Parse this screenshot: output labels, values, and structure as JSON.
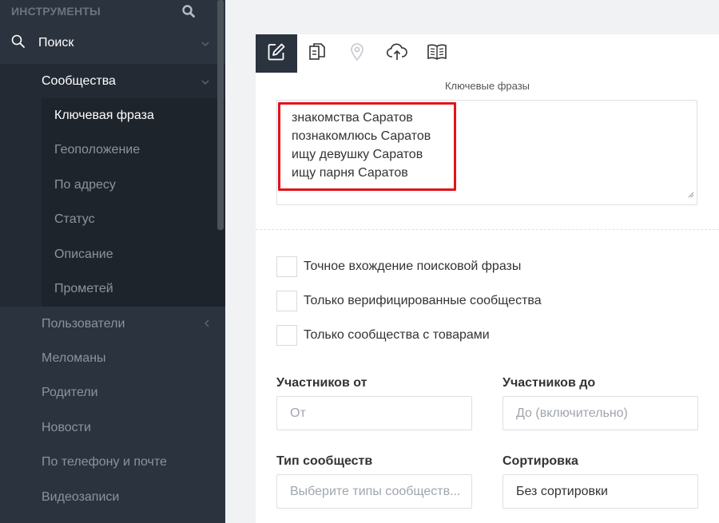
{
  "sidebar": {
    "header_title": "ИНСТРУМЕНТЫ",
    "search_label": "Поиск",
    "communities_label": "Сообщества",
    "leaf_items": [
      "Ключевая фраза",
      "Геоположение",
      "По адресу",
      "Статус",
      "Описание",
      "Прометей"
    ],
    "items": [
      "Пользователи",
      "Меломаны",
      "Родители",
      "Новости",
      "По телефону и почте",
      "Видеозаписи"
    ]
  },
  "toolbar": {
    "icons": [
      "edit-icon",
      "copy-icon",
      "location-icon",
      "cloud-upload-icon",
      "book-icon"
    ]
  },
  "form": {
    "keywords_label": "Ключевые фразы",
    "keywords": [
      "знакомства Саратов",
      "познакомлюсь Саратов",
      "ищу девушку Саратов",
      "ищу парня Саратов"
    ],
    "checkboxes": [
      "Точное вхождение поисковой фразы",
      "Только верифицированные сообщества",
      "Только сообщества с товарами"
    ],
    "members_from_label": "Участников от",
    "members_from_placeholder": "От",
    "members_to_label": "Участников до",
    "members_to_placeholder": "До (включительно)",
    "type_label": "Тип сообществ",
    "type_placeholder": "Выберите типы сообществ...",
    "sort_label": "Сортировка",
    "sort_value": "Без сортировки"
  },
  "colors": {
    "sidebar_bg": "#2b333e",
    "highlight_red": "#e3131b"
  }
}
